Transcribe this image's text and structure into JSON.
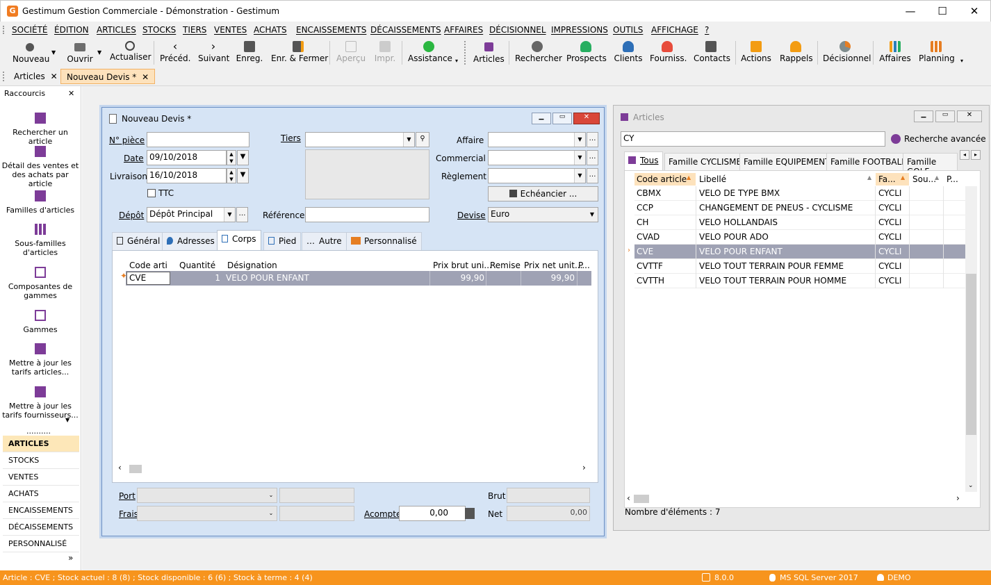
{
  "window": {
    "title": "Gestimum Gestion Commerciale - Démonstration - Gestimum",
    "app_icon": "G"
  },
  "menu": [
    "SOCIÉTÉ",
    "ÉDITION",
    "ARTICLES",
    "STOCKS",
    "TIERS",
    "VENTES",
    "ACHATS",
    "ENCAISSEMENTS",
    "DÉCAISSEMENTS",
    "AFFAIRES",
    "DÉCISIONNEL",
    "IMPRESSIONS",
    "OUTILS",
    "AFFICHAGE",
    "?"
  ],
  "toolbar": {
    "nouveau": "Nouveau",
    "ouvrir": "Ouvrir",
    "actualiser": "Actualiser",
    "preced": "Précéd.",
    "suivant": "Suivant",
    "enreg": "Enreg.",
    "enr_fermer": "Enr. & Fermer",
    "apercu": "Aperçu",
    "impr": "Impr.",
    "assistance": "Assistance",
    "articles": "Articles",
    "rechercher": "Rechercher",
    "prospects": "Prospects",
    "clients": "Clients",
    "fourniss": "Fourniss.",
    "contacts": "Contacts",
    "actions": "Actions",
    "rappels": "Rappels",
    "decisionnel": "Décisionnel",
    "affaires": "Affaires",
    "planning": "Planning"
  },
  "doc_tabs": [
    {
      "label": "Articles"
    },
    {
      "label": "Nouveau Devis *"
    }
  ],
  "sidebar": {
    "title": "Raccourcis",
    "shortcuts": [
      "Rechercher un article",
      "Détail des ventes et des achats par article",
      "Familles d'articles",
      "Sous-familles d'articles",
      "Composantes de gammes",
      "Gammes",
      "Mettre à jour les tarifs articles...",
      "Mettre à jour les tarifs fournisseurs..."
    ],
    "more": "..........",
    "modules": [
      "ARTICLES",
      "STOCKS",
      "VENTES",
      "ACHATS",
      "ENCAISSEMENTS",
      "DÉCAISSEMENTS",
      "PERSONNALISÉ"
    ],
    "chevron": "»"
  },
  "devis": {
    "title": "Nouveau Devis *",
    "labels": {
      "piece": "N° pièce",
      "date": "Date",
      "livraison": "Livraison",
      "ttc": "TTC",
      "depot": "Dépôt",
      "tiers": "Tiers",
      "reference": "Référence",
      "affaire": "Affaire",
      "commercial": "Commercial",
      "reglement": "Règlement",
      "devise": "Devise"
    },
    "values": {
      "piece": "",
      "date": "09/10/2018",
      "livraison": "16/10/2018",
      "depot": "Dépôt Principal",
      "devise": "Euro",
      "echeancier": "Echéancier ..."
    },
    "tabs": [
      "Général",
      "Adresses",
      "Corps",
      "Pied",
      "Autre",
      "Personnalisé"
    ],
    "grid_headers": [
      "Code arti",
      "Quantité",
      "Désignation",
      "Prix brut uni...",
      "Remise",
      "Prix net unit...",
      "P..."
    ],
    "grid_row": {
      "code": "CVE",
      "qte": "1",
      "designation": "VELO POUR ENFANT",
      "prix_brut": "99,90",
      "remise": "",
      "prix_net": "99,90"
    },
    "footer": {
      "port": "Port",
      "frais": "Frais",
      "acompte": "Acompte",
      "acompte_val": "0,00",
      "brut": "Brut",
      "net": "Net",
      "net_val": "0,00"
    }
  },
  "articles": {
    "title": "Articles",
    "search": "CY",
    "advanced": "Recherche avancée",
    "tabs": [
      "Tous",
      "Famille CYCLISME",
      "Famille EQUIPEMENT",
      "Famille FOOTBALL",
      "Famille GOLF"
    ],
    "headers": [
      "Code article",
      "Libellé",
      "Fa...",
      "Sou...",
      "P..."
    ],
    "rows": [
      {
        "code": "CBMX",
        "lib": "VELO DE TYPE BMX",
        "fam": "CYCLI"
      },
      {
        "code": "CCP",
        "lib": "CHANGEMENT DE PNEUS - CYCLISME",
        "fam": "CYCLI"
      },
      {
        "code": "CH",
        "lib": "VELO HOLLANDAIS",
        "fam": "CYCLI"
      },
      {
        "code": "CVAD",
        "lib": "VELO POUR ADO",
        "fam": "CYCLI"
      },
      {
        "code": "CVE",
        "lib": "VELO POUR ENFANT",
        "fam": "CYCLI"
      },
      {
        "code": "CVTTF",
        "lib": "VELO TOUT TERRAIN POUR FEMME",
        "fam": "CYCLI"
      },
      {
        "code": "CVTTH",
        "lib": "VELO TOUT TERRAIN POUR HOMME",
        "fam": "CYCLI"
      }
    ],
    "count": "Nombre d'éléments : 7"
  },
  "status": {
    "left": "Article : CVE ; Stock actuel : 8 (8) ; Stock disponible : 6 (6) ; Stock à terme : 4 (4)",
    "version": "8.0.0",
    "db": "MS SQL Server 2017",
    "user": "DEMO"
  },
  "colors": {
    "orange": "#f7941d",
    "selection": "#9fa2b4"
  }
}
